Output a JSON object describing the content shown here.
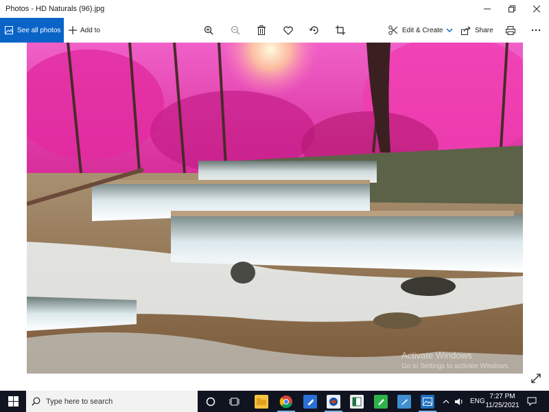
{
  "window": {
    "title": "Photos - HD Naturals (96).jpg"
  },
  "toolbar": {
    "see_all_label": "See all photos",
    "add_to_label": "Add to",
    "edit_create_label": "Edit & Create",
    "share_label": "Share"
  },
  "photo": {
    "description_icon": "image",
    "watermark_line1": "Activate Windows",
    "watermark_line2": "Go to Settings to activate Windows."
  },
  "taskbar": {
    "search_placeholder": "Type here to search",
    "language": "ENG",
    "time": "7:27 PM",
    "date": "11/25/2021"
  },
  "colors": {
    "accent": "#0a64c8",
    "taskbar": "#101420",
    "foliage": "#e0209a"
  }
}
